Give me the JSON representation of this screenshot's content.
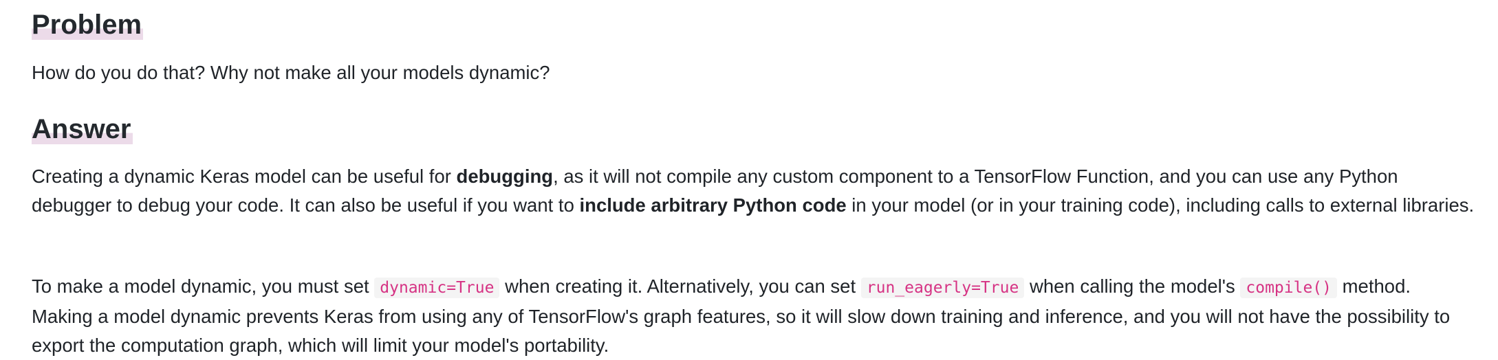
{
  "problem": {
    "heading": "Problem",
    "text": "How do you do that? Why not make all your models dynamic?"
  },
  "answer": {
    "heading": "Answer",
    "p1": {
      "t1": "Creating a dynamic Keras model can be useful for ",
      "b1": "debugging",
      "t2": ", as it will not compile any custom component to a TensorFlow Function, and you can use any Python debugger to debug your code. It can also be useful if you want to ",
      "b2": "include arbitrary Python code",
      "t3": " in your model (or in your training code), including calls to external libraries."
    },
    "p2": {
      "t1": "To make a model dynamic, you must set ",
      "c1": "dynamic=True",
      "t2": " when creating it. Alternatively, you can set ",
      "c2": "run_eagerly=True",
      "t3": " when calling the model's ",
      "c3": "compile()",
      "t4": " method. Making a model dynamic prevents Keras from using any of TensorFlow's graph features, so it will slow down training and inference, and you will not have the possibility to export the computation graph, which will limit your model's portability."
    }
  },
  "colors": {
    "heading_highlight": "#ecdbe9",
    "code_text": "#d63384",
    "code_background": "#f4f4f4"
  }
}
